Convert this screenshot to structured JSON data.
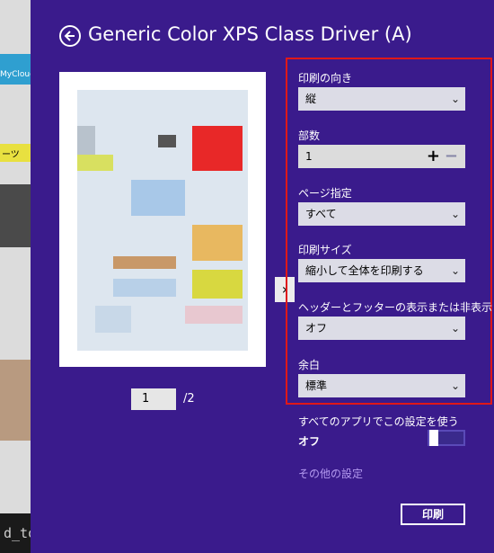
{
  "dialog": {
    "title": "Generic Color XPS Class Driver (A)"
  },
  "preview": {
    "current_page": "1",
    "total_pages": "/2",
    "next_glyph": "›"
  },
  "settings": {
    "orientation": {
      "label": "印刷の向き",
      "value": "縦"
    },
    "copies": {
      "label": "部数",
      "value": "1",
      "plus": "+",
      "minus": "−"
    },
    "page_range": {
      "label": "ページ指定",
      "value": "すべて"
    },
    "print_size": {
      "label": "印刷サイズ",
      "value": "縮小して全体を印刷する"
    },
    "header_footer": {
      "label": "ヘッダーとフッターの表示または非表示",
      "value": "オフ"
    },
    "margin": {
      "label": "余白",
      "value": "標準"
    }
  },
  "all_apps": {
    "label": "すべてのアプリでこの設定を使う",
    "state": "オフ"
  },
  "more_settings": "その他の設定",
  "print_button": "印刷",
  "background": {
    "fragment_1": "MyCloud",
    "fragment_2": "ーツ",
    "fragment_3": "d_to"
  },
  "colors": {
    "panel_bg": "#3a1b8c",
    "highlight_border": "#e01818",
    "link": "#b49af0"
  }
}
